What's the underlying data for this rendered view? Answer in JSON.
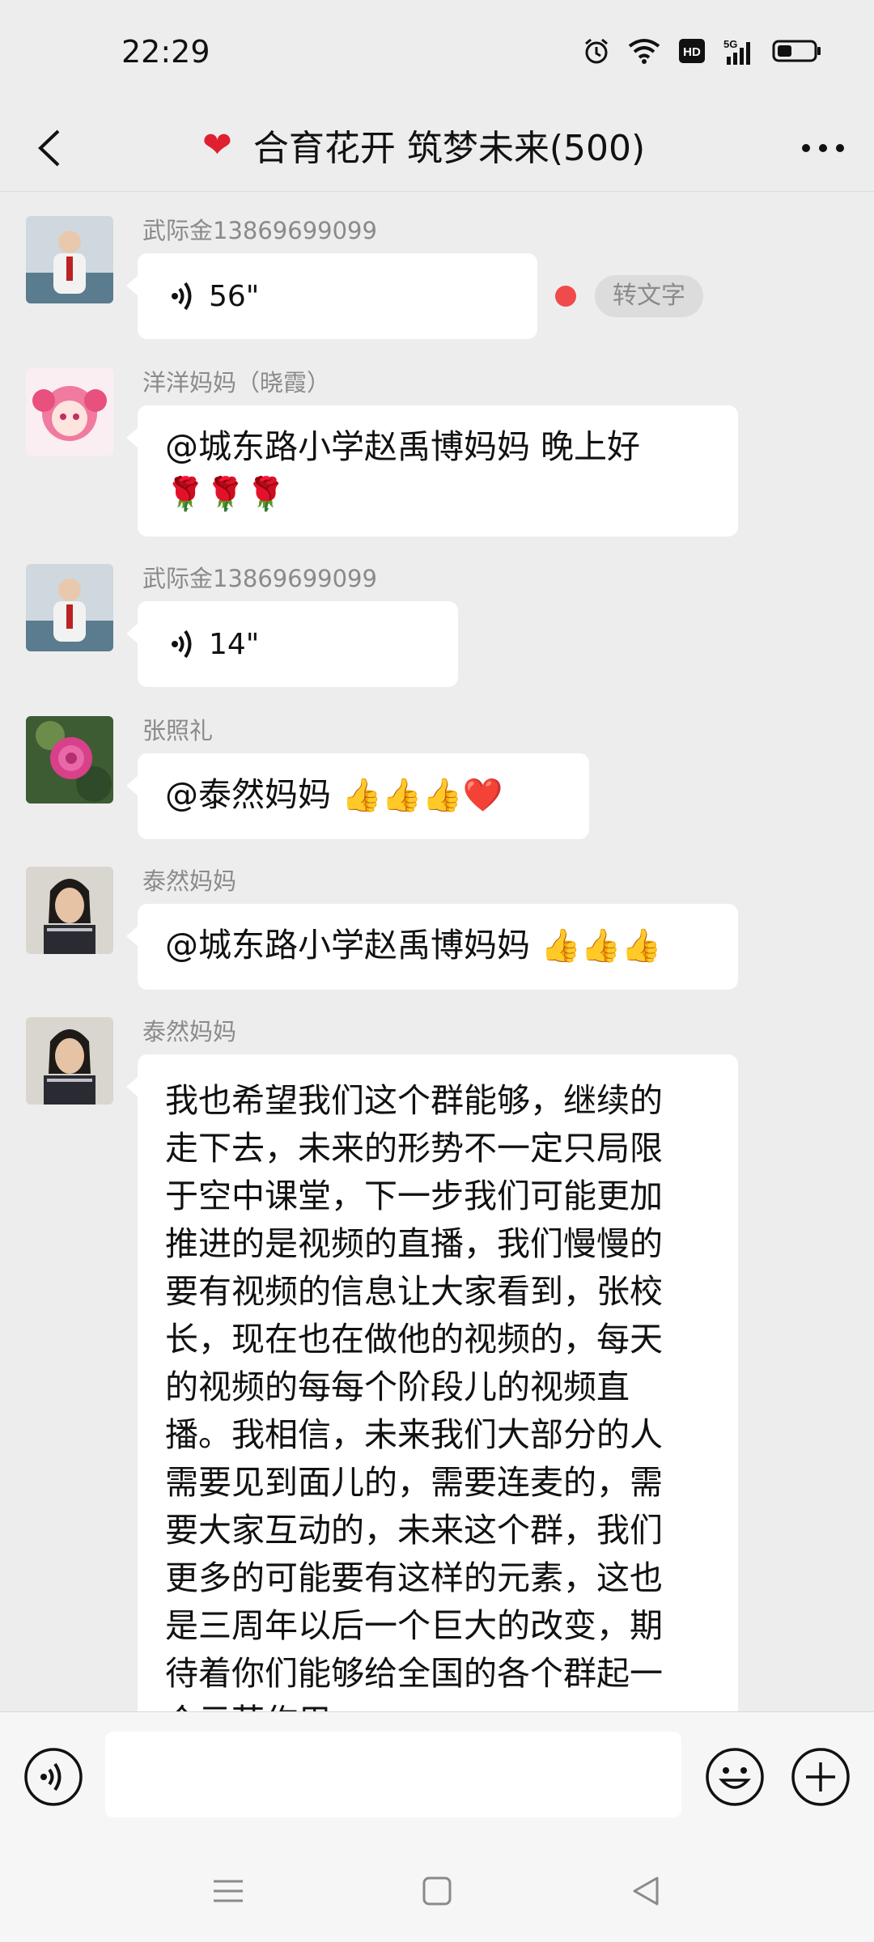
{
  "status": {
    "time": "22:29"
  },
  "header": {
    "title": "合育花开 筑梦未来(500)"
  },
  "messages": [
    {
      "sender": "武际金13869699099",
      "voice": "56\"",
      "to_text": "转文字"
    },
    {
      "sender": "洋洋妈妈（晓霞）",
      "line1": "@城东路小学赵禹博妈妈  晚上好",
      "line2": "🌹🌹🌹"
    },
    {
      "sender": "武际金13869699099",
      "voice": "14\""
    },
    {
      "sender": "张照礼",
      "text": "@泰然妈妈",
      "emoji": "👍👍👍❤️"
    },
    {
      "sender": "泰然妈妈",
      "text": "@城东路小学赵禹博妈妈",
      "emoji": "👍👍👍"
    },
    {
      "sender": "泰然妈妈",
      "lines": [
        "我也希望我们这个群能够，继续的",
        "走下去，未来的形势不一定只局限",
        "于空中课堂，下一步我们可能更加",
        "推进的是视频的直播，我们慢慢的",
        "要有视频的信息让大家看到，张校",
        "长，现在也在做他的视频的，每天",
        "的视频的每每个阶段儿的视频直",
        "播。我相信，未来我们大部分的人",
        "需要见到面儿的，需要连麦的，需",
        "要大家互动的，未来这个群，我们",
        "更多的可能要有这样的元素，这也",
        "是三周年以后一个巨大的改变，期",
        "待着你们能够给全国的各个群起一",
        "个示范作用"
      ]
    }
  ]
}
